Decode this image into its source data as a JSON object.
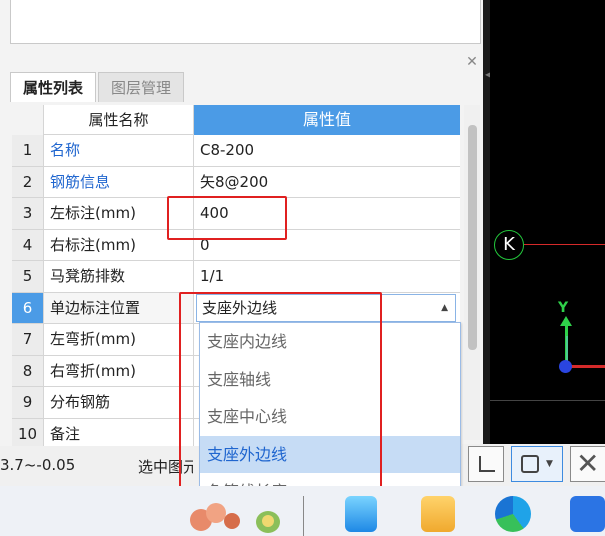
{
  "panel": {
    "close_icon": "close-icon",
    "tabs": [
      {
        "label": "属性列表",
        "active": true
      },
      {
        "label": "图层管理",
        "active": false
      }
    ],
    "grid": {
      "header_name": "属性名称",
      "header_value": "属性值",
      "rows": [
        {
          "num": "1",
          "name": "名称",
          "value": "C8-200",
          "name_blue": true
        },
        {
          "num": "2",
          "name": "钢筋信息",
          "value": "⽮8@200",
          "name_blue": true
        },
        {
          "num": "3",
          "name": "左标注(mm)",
          "value": "400",
          "name_blue": false
        },
        {
          "num": "4",
          "name": "右标注(mm)",
          "value": "0",
          "name_blue": false
        },
        {
          "num": "5",
          "name": "马凳筋排数",
          "value": "1/1",
          "name_blue": false
        },
        {
          "num": "6",
          "name": "单边标注位置",
          "value": "支座外边线",
          "name_blue": false
        },
        {
          "num": "7",
          "name": "左弯折(mm)",
          "value": "",
          "name_blue": false
        },
        {
          "num": "8",
          "name": "右弯折(mm)",
          "value": "",
          "name_blue": false
        },
        {
          "num": "9",
          "name": "分布钢筋",
          "value": "",
          "name_blue": false
        },
        {
          "num": "10",
          "name": "备注",
          "value": "",
          "name_blue": false
        }
      ]
    },
    "dropdown": {
      "selected": "支座外边线",
      "options": [
        "支座内边线",
        "支座轴线",
        "支座中心线",
        "支座外边线",
        "负筋线长度"
      ],
      "highlighted_index": 3
    }
  },
  "status": {
    "coord": "3.7~-0.05",
    "selected_text": "选中图元"
  },
  "canvas": {
    "marker_label": "K",
    "axis_y_label": "Y"
  },
  "toolbar": {
    "icons": [
      "corner-select-icon",
      "rect-select-icon",
      "cross-select-icon"
    ]
  },
  "colors": {
    "accent": "#4b9be6",
    "highlight_red": "#e02020",
    "canvas_bg": "#000000",
    "axis_green": "#2fd14a",
    "axis_red": "#d52a2a",
    "origin_blue": "#2a45e0"
  }
}
